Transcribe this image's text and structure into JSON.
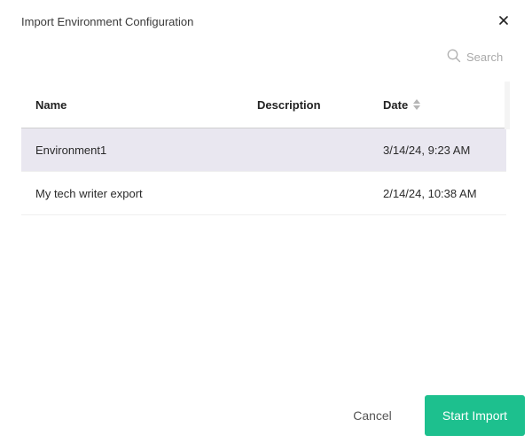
{
  "dialog": {
    "title": "Import Environment Configuration"
  },
  "search": {
    "placeholder": "Search",
    "value": ""
  },
  "table": {
    "columns": {
      "name": "Name",
      "description": "Description",
      "date": "Date"
    },
    "rows": [
      {
        "name": "Environment1",
        "description": "",
        "date": "3/14/24, 9:23 AM",
        "selected": true
      },
      {
        "name": "My tech writer export",
        "description": "",
        "date": "2/14/24, 10:38 AM",
        "selected": false
      }
    ]
  },
  "footer": {
    "cancel_label": "Cancel",
    "start_label": "Start Import"
  },
  "colors": {
    "accent": "#1dc08e",
    "selected_row": "#e9e7f0"
  },
  "icons": {
    "close": "close-icon",
    "search": "search-icon",
    "sort": "sort-icon"
  }
}
